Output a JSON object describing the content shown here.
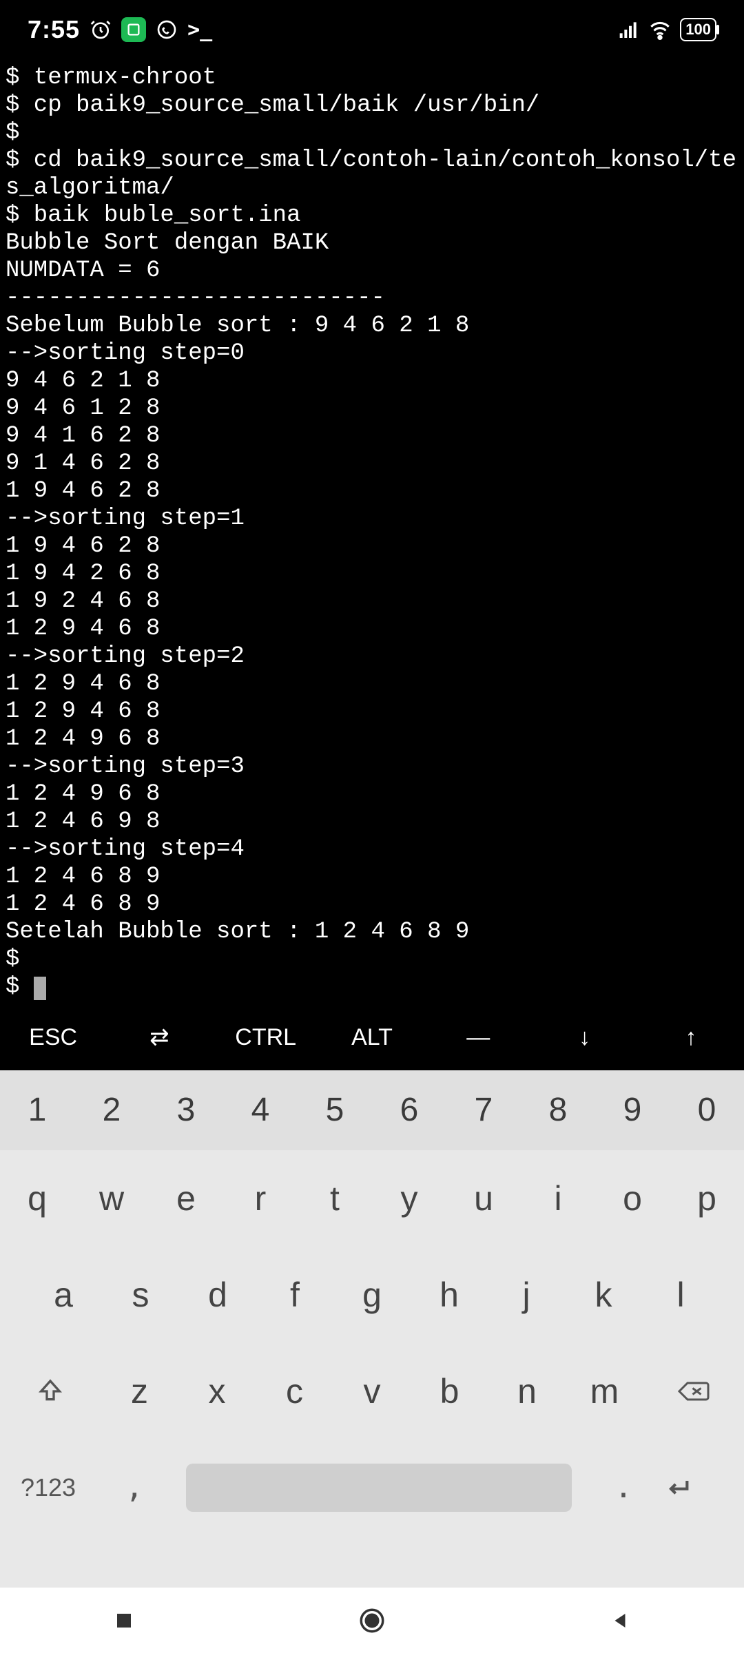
{
  "status": {
    "time": "7:55",
    "battery": "100"
  },
  "terminal": {
    "lines": [
      "$ termux-chroot",
      "$ cp baik9_source_small/baik /usr/bin/",
      "$",
      "$ cd baik9_source_small/contoh-lain/contoh_konsol/tes_algoritma/",
      "$ baik buble_sort.ina",
      "Bubble Sort dengan BAIK",
      "NUMDATA = 6",
      "---------------------------",
      "Sebelum Bubble sort : 9 4 6 2 1 8 ",
      "-->sorting step=0",
      "9 4 6 2 1 8 ",
      "9 4 6 1 2 8 ",
      "9 4 1 6 2 8 ",
      "9 1 4 6 2 8 ",
      "1 9 4 6 2 8 ",
      "-->sorting step=1",
      "1 9 4 6 2 8 ",
      "1 9 4 2 6 8 ",
      "1 9 2 4 6 8 ",
      "1 2 9 4 6 8 ",
      "-->sorting step=2",
      "1 2 9 4 6 8 ",
      "1 2 9 4 6 8 ",
      "1 2 4 9 6 8 ",
      "-->sorting step=3",
      "1 2 4 9 6 8 ",
      "1 2 4 6 9 8 ",
      "-->sorting step=4",
      "1 2 4 6 8 9 ",
      "1 2 4 6 8 9 ",
      "Setelah Bubble sort : 1 2 4 6 8 9 ",
      "$",
      "$ "
    ]
  },
  "extra_keys": [
    "ESC",
    "⇄",
    "CTRL",
    "ALT",
    "―",
    "↓",
    "↑"
  ],
  "keyboard": {
    "nums": [
      "1",
      "2",
      "3",
      "4",
      "5",
      "6",
      "7",
      "8",
      "9",
      "0"
    ],
    "row1": [
      "q",
      "w",
      "e",
      "r",
      "t",
      "y",
      "u",
      "i",
      "o",
      "p"
    ],
    "row2": [
      "a",
      "s",
      "d",
      "f",
      "g",
      "h",
      "j",
      "k",
      "l"
    ],
    "row3": [
      "z",
      "x",
      "c",
      "v",
      "b",
      "n",
      "m"
    ],
    "sym": "?123",
    "comma": ",",
    "period": "."
  }
}
